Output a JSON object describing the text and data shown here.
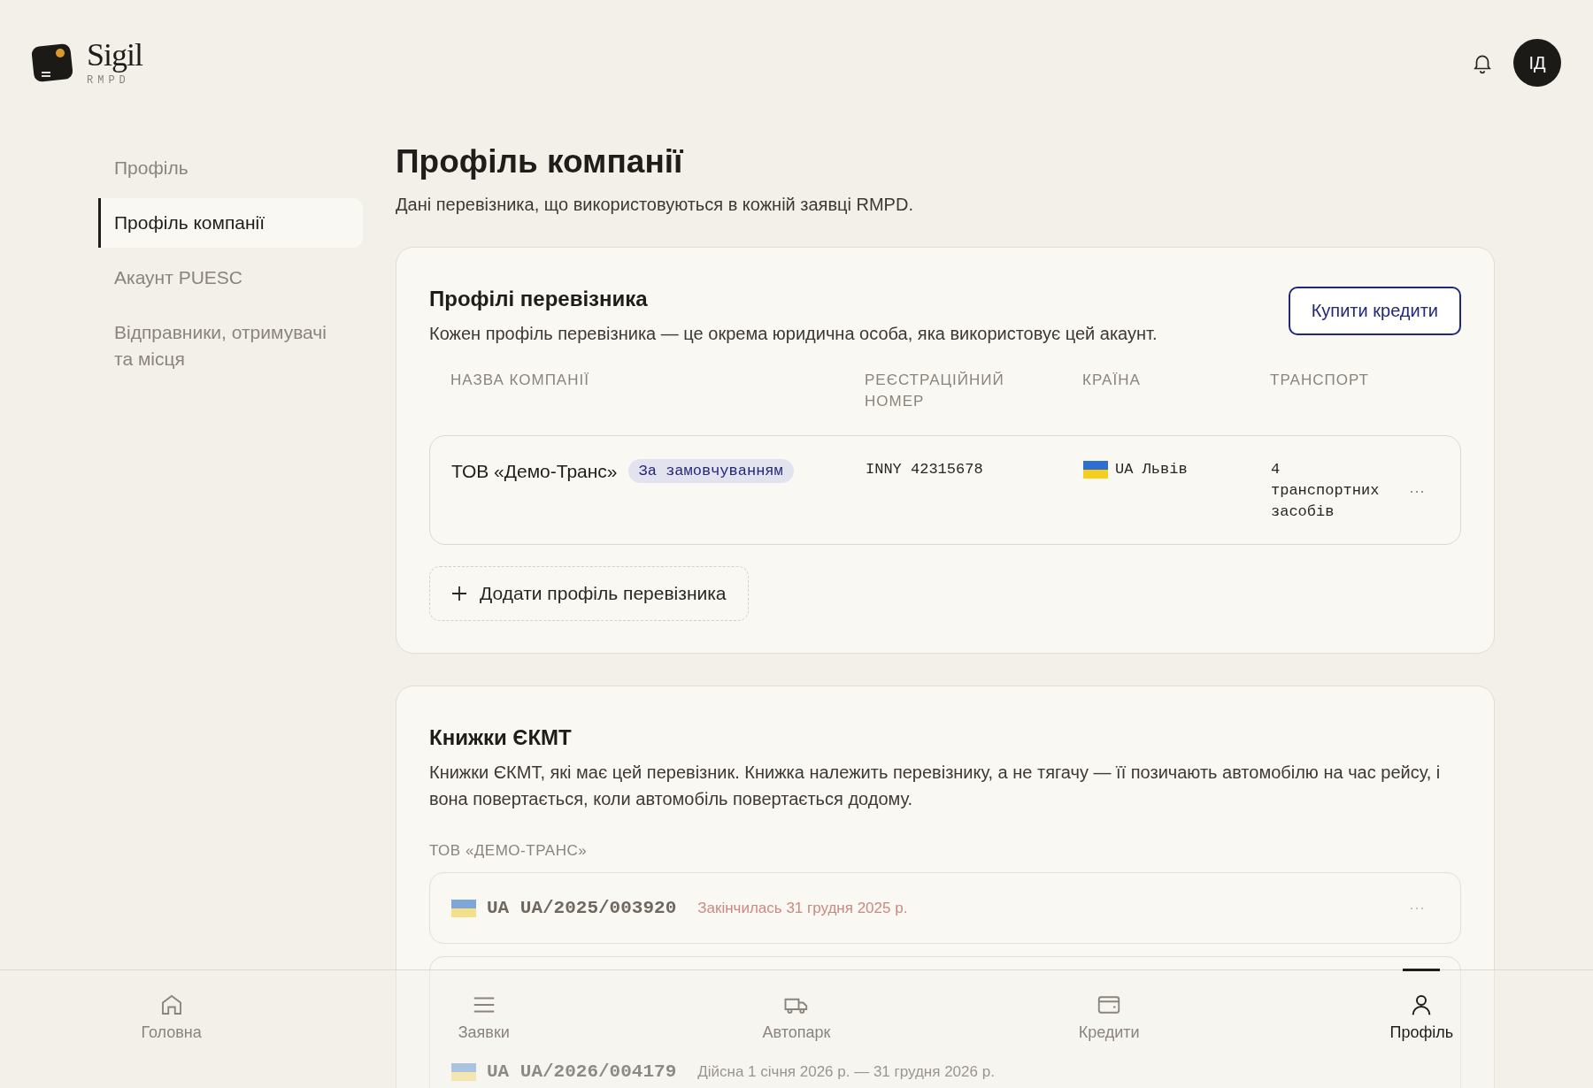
{
  "brand": {
    "name": "Sigil",
    "tagline": "RMPD"
  },
  "header": {
    "avatar_initials": "ІД"
  },
  "sidebar": {
    "items": [
      {
        "label": "Профіль",
        "selected": false
      },
      {
        "label": "Профіль компанії",
        "selected": true
      },
      {
        "label": "Акаунт PUESC",
        "selected": false
      },
      {
        "label": "Відправники, отримувачі та місця",
        "selected": false
      }
    ]
  },
  "page": {
    "title": "Профіль компанії",
    "subtitle": "Дані перевізника, що використовуються в кожній заявці RMPD."
  },
  "carriers": {
    "title": "Профілі перевізника",
    "description": "Кожен профіль перевізника — це окрема юридична особа, яка використовує цей акаунт.",
    "buy_button": "Купити кредити",
    "columns": [
      "НАЗВА КОМПАНІЇ",
      "РЕЄСТРАЦІЙНИЙ НОМЕР",
      "КРАЇНА",
      "ТРАНСПОРТ"
    ],
    "rows": [
      {
        "name": "ТОВ «Демо-Транс»",
        "badge": "За замовчуванням",
        "reg_number": "INNY 42315678",
        "country": "UA Львів",
        "transport": "4 транспортних засобів",
        "menu": "···"
      }
    ],
    "add_button": "Додати профіль перевізника"
  },
  "books": {
    "title": "Книжки ЄКМТ",
    "description": "Книжки ЄКМТ, які має цей перевізник. Книжка належить перевізнику, а не тягачу — її позичають автомобілю на час рейсу, і вона повертається, коли автомобіль повертається додому.",
    "groups": [
      {
        "label": "ТОВ «ДЕМО-ТРАНС»",
        "items": [
          {
            "number": "UA UA/2025/003920",
            "status": "Закінчилась 31 грудня 2025 р.",
            "expired": true,
            "menu": "···"
          },
          {
            "number": "UA UA/2026/004179",
            "status": "Дійсна 1 січня 2026 р. — 31 грудня 2026 р.",
            "expired": false
          }
        ]
      }
    ]
  },
  "bottom_nav": [
    {
      "label": "Головна",
      "selected": false
    },
    {
      "label": "Заявки",
      "selected": false
    },
    {
      "label": "Автопарк",
      "selected": false
    },
    {
      "label": "Кредити",
      "selected": false
    },
    {
      "label": "Профіль",
      "selected": true
    }
  ]
}
